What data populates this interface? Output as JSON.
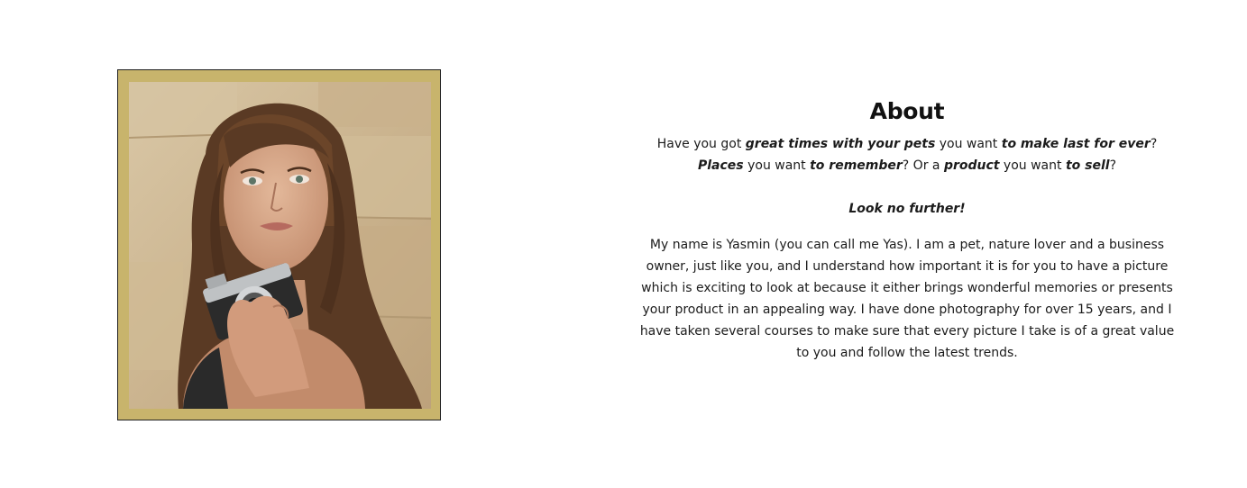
{
  "about": {
    "title": "About",
    "intro": {
      "t1": "Have you got ",
      "b1": "great times with your pets",
      "t2": " you want ",
      "b2": "to make last for ever",
      "t3": "? ",
      "b3": "Places",
      "t4": " you want ",
      "b4": "to remember",
      "t5": "? Or a ",
      "b5": "product",
      "t6": " you want ",
      "b6": "to sell",
      "t7": "?"
    },
    "tagline": "Look no further!",
    "bio": "My name is Yasmin (you can call me Yas). I am a pet, nature lover and a business owner, just like you, and I understand how important it is for you to have a picture which is exciting to look at because it either brings wonderful memories or presents your product in an appealing way. I have done photography for over 15 years, and I have taken several courses to make sure that every picture I take is of a great value to you and follow the latest trends."
  },
  "photo": {
    "icon": "photographer-portrait-image",
    "frame_color": "#c8b46c"
  }
}
